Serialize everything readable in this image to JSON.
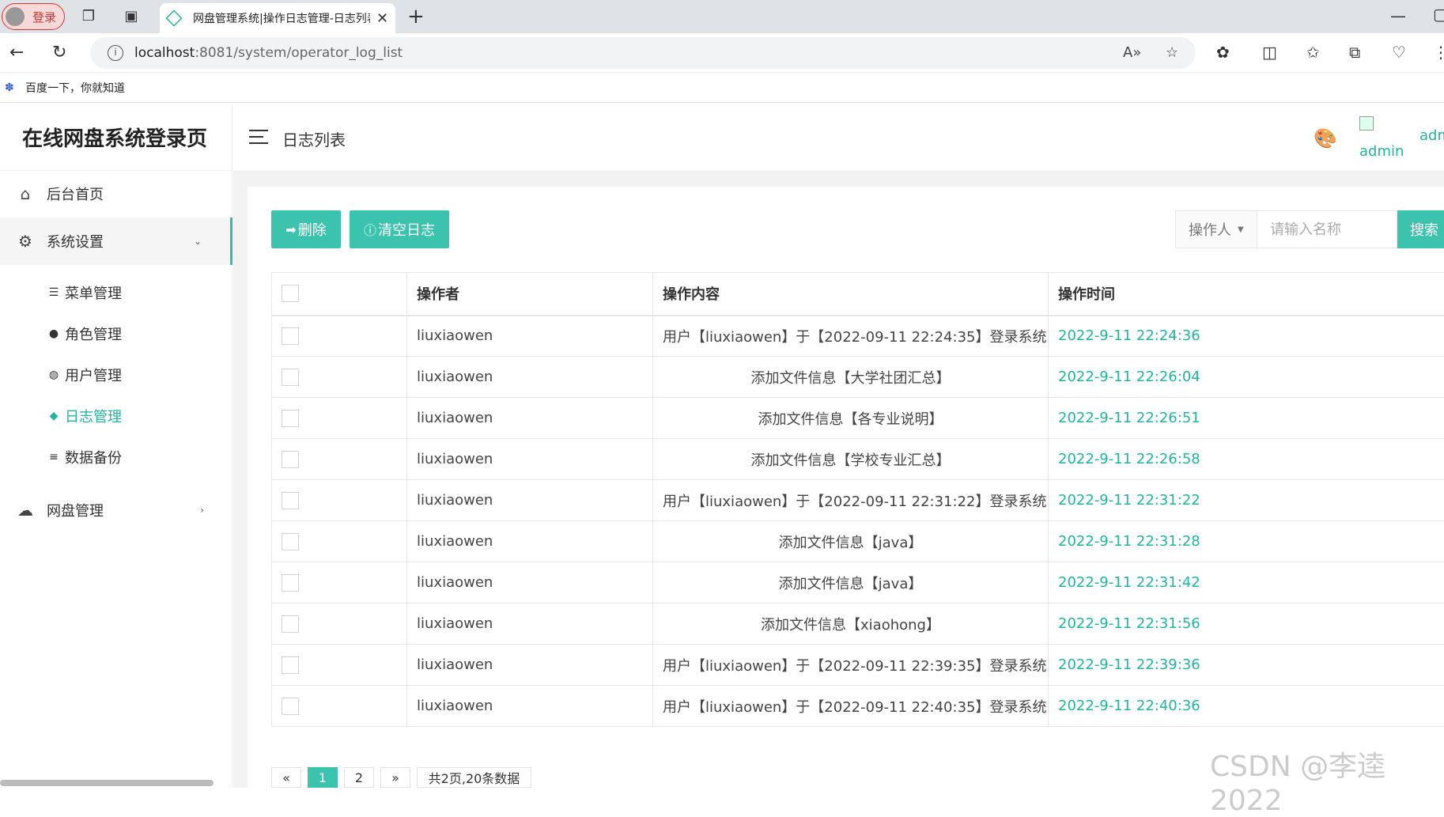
{
  "browser": {
    "profile_label": "登录",
    "tab_title": "网盘管理系统|操作日志管理-日志列表",
    "url_host": "localhost",
    "url_path": ":8081/system/operator_log_list",
    "bookmark_label": "百度一下，你就知道"
  },
  "sidebar": {
    "logo": "在线网盘系统登录页",
    "items": [
      {
        "icon": "home-icon",
        "label": "后台首页"
      },
      {
        "icon": "gear-icon",
        "label": "系统设置"
      },
      {
        "icon": "cloud-icon",
        "label": "网盘管理"
      }
    ],
    "sub_items": [
      {
        "icon": "list-icon",
        "label": "菜单管理"
      },
      {
        "icon": "user-gear-icon",
        "label": "角色管理"
      },
      {
        "icon": "users-icon",
        "label": "用户管理"
      },
      {
        "icon": "tag-icon",
        "label": "日志管理"
      },
      {
        "icon": "database-icon",
        "label": "数据备份"
      }
    ]
  },
  "header": {
    "breadcrumb": "日志列表",
    "avatar_alt": "admin",
    "username": "admin"
  },
  "toolbar": {
    "delete_label": "删除",
    "clear_label": "清空日志",
    "filter_select": "操作人",
    "search_placeholder": "请输入名称",
    "search_label": "搜索"
  },
  "table": {
    "columns": [
      "操作者",
      "操作内容",
      "操作时间"
    ],
    "rows": [
      {
        "operator": "liuxiaowen",
        "content": "用户【liuxiaowen】于【2022-09-11 22:24:35】登录系统!",
        "time": "2022-9-11 22:24:36"
      },
      {
        "operator": "liuxiaowen",
        "content": "添加文件信息【大学社团汇总】",
        "time": "2022-9-11 22:26:04"
      },
      {
        "operator": "liuxiaowen",
        "content": "添加文件信息【各专业说明】",
        "time": "2022-9-11 22:26:51"
      },
      {
        "operator": "liuxiaowen",
        "content": "添加文件信息【学校专业汇总】",
        "time": "2022-9-11 22:26:58"
      },
      {
        "operator": "liuxiaowen",
        "content": "用户【liuxiaowen】于【2022-09-11 22:31:22】登录系统!",
        "time": "2022-9-11 22:31:22"
      },
      {
        "operator": "liuxiaowen",
        "content": "添加文件信息【java】",
        "time": "2022-9-11 22:31:28"
      },
      {
        "operator": "liuxiaowen",
        "content": "添加文件信息【java】",
        "time": "2022-9-11 22:31:42"
      },
      {
        "operator": "liuxiaowen",
        "content": "添加文件信息【xiaohong】",
        "time": "2022-9-11 22:31:56"
      },
      {
        "operator": "liuxiaowen",
        "content": "用户【liuxiaowen】于【2022-09-11 22:39:35】登录系统!",
        "time": "2022-9-11 22:39:36"
      },
      {
        "operator": "liuxiaowen",
        "content": "用户【liuxiaowen】于【2022-09-11 22:40:35】登录系统!",
        "time": "2022-9-11 22:40:36"
      }
    ]
  },
  "pagination": {
    "prev": "«",
    "pages": [
      "1",
      "2"
    ],
    "current": "1",
    "next": "»",
    "summary": "共2页,20条数据"
  },
  "watermark": "CSDN @李逵2022",
  "colors": {
    "accent": "#3cc3ae",
    "time_text": "#1fb5a0"
  }
}
